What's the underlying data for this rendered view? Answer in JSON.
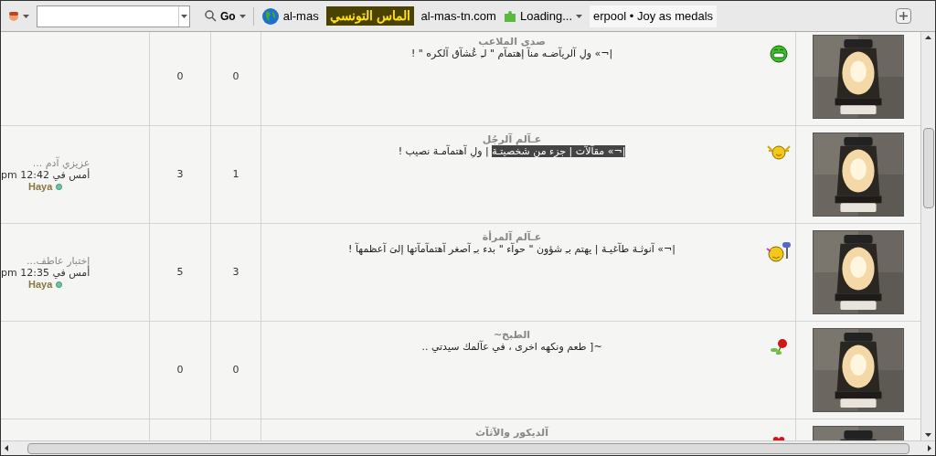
{
  "toolbar": {
    "go_label": "Go",
    "site_label": "al-mas",
    "logo_text": "الماس التونسي",
    "domain": "al-mas-tn.com",
    "loading_label": "Loading...",
    "ticker": "erpool • Joy as medals"
  },
  "forums": [
    {
      "title": "صدى الملاعب",
      "kind": "grin",
      "description": [
        {
          "text": "|¬» ولِ آلريآضـه منآ إهتمآم \" لـِ عُشآق آلكره \" !",
          "selected": false
        }
      ],
      "column_2": "0",
      "column_3": "0"
    },
    {
      "title": "عـآلم آلرجُل",
      "kind": "cheer",
      "description": [
        {
          "text": "|¬» مقآلآت | جزء من شخصيتـة",
          "selected": true
        },
        {
          "text": " | ولِ آهتمآمـة نصيب !",
          "selected": false
        }
      ],
      "column_2": "3",
      "column_3": "1",
      "last_post": {
        "title": "عزيزي آدم ...",
        "time": "أمس في 12:42 pm",
        "user": "Haya",
        "online": true
      }
    },
    {
      "title": "عـآلم آلمرأة",
      "kind": "hairdryer",
      "description": [
        {
          "text": "|¬» آنوثـة طآغيـة | يهتم بـِ شؤون \" حوآء \" بدء بـِ آصغر آهتمآمآتها إلىَ آعظمهآ !",
          "selected": false
        }
      ],
      "column_2": "5",
      "column_3": "3",
      "last_post": {
        "title": "إختبار عاطف...",
        "time": "أمس في 12:35 pm",
        "user": "Haya",
        "online": true
      }
    },
    {
      "title": "الطبخ~",
      "kind": "rose",
      "description": [
        {
          "text": "~[ طعم ونكهه اخرى ، في عآلمك سيدتي ..",
          "selected": false
        }
      ],
      "column_2": "0",
      "column_3": "0"
    },
    {
      "title": "آلديكور والآثآث",
      "kind": "heart"
    }
  ]
}
